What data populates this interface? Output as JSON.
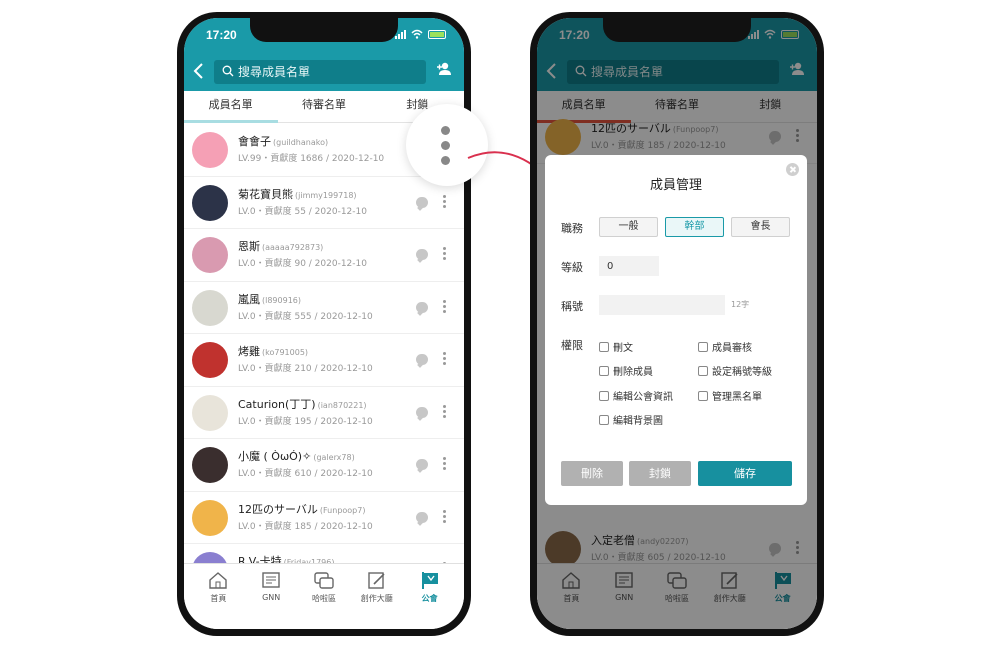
{
  "status_time": "17:20",
  "search": {
    "placeholder": "搜尋成員名單"
  },
  "tabs": [
    "成員名單",
    "待審名單",
    "封鎖"
  ],
  "members": [
    {
      "name": "會會子",
      "id": "(guildhanako)",
      "info": "LV.99・貢獻度 1686 / 2020-12-10",
      "avatar_color": "#f5a0b5"
    },
    {
      "name": "菊花寶貝熊",
      "id": "(jimmy199718)",
      "info": "LV.0・貢獻度 55 / 2020-12-10",
      "avatar_color": "#2c3348"
    },
    {
      "name": "恩斯",
      "id": "(aaaaa792873)",
      "info": "LV.0・貢獻度 90 / 2020-12-10",
      "avatar_color": "#d99ab0"
    },
    {
      "name": "嵐風",
      "id": "(l890916)",
      "info": "LV.0・貢獻度 555 / 2020-12-10",
      "avatar_color": "#d8d8d0"
    },
    {
      "name": "烤雞",
      "id": "(ko791005)",
      "info": "LV.0・貢獻度 210 / 2020-12-10",
      "avatar_color": "#c0322e"
    },
    {
      "name": "Caturion(丁丁)",
      "id": "(ian870221)",
      "info": "LV.0・貢獻度 195 / 2020-12-10",
      "avatar_color": "#e8e4da"
    },
    {
      "name": "小魔 ( ÒωÓ)✧",
      "id": "(galerx78)",
      "info": "LV.0・貢獻度 610 / 2020-12-10",
      "avatar_color": "#3a2e2e"
    },
    {
      "name": "12匹のサーバル",
      "id": "(Funpoop7)",
      "info": "LV.0・貢獻度 185 / 2020-12-10",
      "avatar_color": "#f0b44a"
    },
    {
      "name": "R.V-卡特",
      "id": "(Friday1796)",
      "info": "LV.0・貢獻度 945 / 2020-12-10",
      "avatar_color": "#8a7fd0"
    }
  ],
  "right_members": [
    {
      "name": "12匹のサーバル",
      "id": "(Funpoop7)",
      "info": "LV.0・貢獻度 185 / 2020-12-10",
      "avatar_color": "#f0b44a"
    },
    {
      "name": "入定老僧",
      "id": "(andy02207)",
      "info": "LV.0・貢獻度 605 / 2020-12-10",
      "avatar_color": "#8a6a4a"
    }
  ],
  "nav": [
    {
      "label": "首頁",
      "icon": "home-icon"
    },
    {
      "label": "GNN",
      "icon": "news-icon"
    },
    {
      "label": "哈啦區",
      "icon": "forum-icon"
    },
    {
      "label": "創作大廳",
      "icon": "creation-icon"
    },
    {
      "label": "公會",
      "icon": "guild-flag-icon",
      "active": true
    }
  ],
  "dialog": {
    "title": "成員管理",
    "role_label": "職務",
    "roles": [
      "一般",
      "幹部",
      "會長"
    ],
    "selected_role": "幹部",
    "level_label": "等級",
    "level_value": "0",
    "nickname_label": "稱號",
    "nickname_limit": "12字",
    "permission_label": "權限",
    "permissions": [
      "刪文",
      "成員審核",
      "刪除成員",
      "設定稱號等級",
      "編輯公會資訊",
      "管理黑名單",
      "編輯背景圖"
    ],
    "buttons": {
      "delete": "刪除",
      "ban": "封鎖",
      "save": "儲存"
    }
  },
  "colors": {
    "accent": "#1a9aa8",
    "accent_dark": "#17909f",
    "disabled": "#b1b1b1"
  }
}
